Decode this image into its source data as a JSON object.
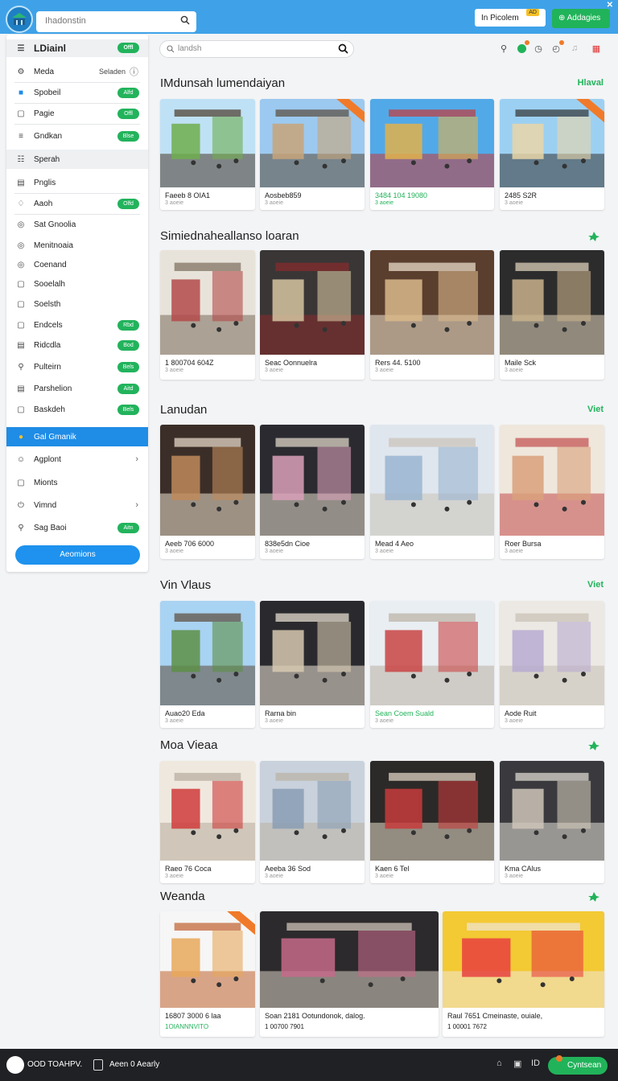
{
  "topbar": {
    "search_placeholder": "Ihadonstin",
    "button_white": "In Picolem",
    "button_white_tag": "AD",
    "button_green": "Addagies",
    "close": "✕"
  },
  "sidebar": {
    "title": "LDiainl",
    "title_pill": "Offl",
    "items": [
      {
        "label": "Meda",
        "right": "Seladen",
        "icon": "gear-icon"
      },
      {
        "label": "Spobeil",
        "pill": "Alfd",
        "icon": "blue-square-icon"
      },
      {
        "label": "Pagie",
        "pill": "Offl",
        "icon": "square-icon"
      },
      {
        "label": "Gndkan",
        "pill": "Blse",
        "icon": "list-icon"
      },
      {
        "label": "Sperah",
        "icon": "sliders-icon"
      },
      {
        "label": "Pnglis",
        "icon": "doc-icon"
      },
      {
        "label": "Aaoh",
        "pill": "Olfd",
        "icon": "bell-icon"
      },
      {
        "label": "Sat Gnoolia",
        "icon": "circle-icon"
      },
      {
        "label": "Menitnoaia",
        "icon": "circle-icon"
      },
      {
        "label": "Coenand",
        "icon": "circle-icon"
      },
      {
        "label": "Sooelalh",
        "icon": "square-icon"
      },
      {
        "label": "Soelsth",
        "icon": "square-icon"
      },
      {
        "label": "Endcels",
        "pill": "Rbd",
        "icon": "square-icon"
      },
      {
        "label": "Ridcdla",
        "pill": "Bod",
        "icon": "doc-icon"
      },
      {
        "label": "Pulteirn",
        "pill": "Bels",
        "icon": "person-icon"
      },
      {
        "label": "Parshelion",
        "pill": "Aitd",
        "icon": "doc-icon"
      },
      {
        "label": "Baskdeh",
        "pill": "Bels",
        "icon": "square-icon"
      },
      {
        "label": "Gal Gmanik",
        "icon": "dot-icon"
      },
      {
        "label": "Agplont",
        "icon": "smile-icon"
      },
      {
        "label": "Mionts",
        "icon": "square-icon"
      },
      {
        "label": "Vimnd",
        "icon": "power-icon"
      },
      {
        "label": "Sag Baoi",
        "pill": "Aitn",
        "icon": "person-icon"
      }
    ],
    "button": "Aeomions"
  },
  "main_search": {
    "placeholder": "landsh"
  },
  "sections": [
    {
      "title": "IMdunsah lumendaiyan",
      "link": "Hlaval",
      "cards": [
        {
          "title": "Faeeb 8 OIA1",
          "sub": "3 aoeie"
        },
        {
          "title": "Aosbeb859",
          "sub": "3 aoeie"
        },
        {
          "title": "3484 104 19080",
          "sub": "3 aoeie"
        },
        {
          "title": "2485 S2R",
          "sub": "3 aoeie"
        }
      ]
    },
    {
      "title": "Simiednaheallanso loaran",
      "link": "",
      "cards": [
        {
          "title": "1 800704 604Z",
          "sub": "3 aoeie"
        },
        {
          "title": "Seac Oonnuelra",
          "sub": "3 aoeie"
        },
        {
          "title": "Rers 44. 5100",
          "sub": "3 aoeie"
        },
        {
          "title": "Maile Sck",
          "sub": "3 aoeie"
        }
      ]
    },
    {
      "title": "Lanudan",
      "link": "Viet",
      "cards": [
        {
          "title": "Aeeb 706 6000",
          "sub": "3 aoeie"
        },
        {
          "title": "838e5dn Cioe",
          "sub": "3 aoeie"
        },
        {
          "title": "Mead 4 Aeo",
          "sub": "3 aoeie"
        },
        {
          "title": "Roer Bursa",
          "sub": "3 aoeie"
        }
      ]
    },
    {
      "title": "Vin Vlaus",
      "link": "Viet",
      "cards": [
        {
          "title": "Auao20 Eda",
          "sub": "3 aoeie"
        },
        {
          "title": "Rarna bin",
          "sub": "3 aoeie"
        },
        {
          "title": "Sean Coem Suald",
          "sub": "3 aoeie"
        },
        {
          "title": "Aode Ruit",
          "sub": "3 aoeie"
        }
      ]
    },
    {
      "title": "Moa Vieaa",
      "link": "",
      "cards": [
        {
          "title": "Raeo 76 Coca",
          "sub": "3 aoeie"
        },
        {
          "title": "Aeeba 36 Sod",
          "sub": "3 aoeie"
        },
        {
          "title": "Kaen 6 Tel",
          "sub": "3 aoeie"
        },
        {
          "title": "Kma CAlus",
          "sub": "3 aoeie"
        }
      ]
    },
    {
      "title": "Weanda",
      "link": "",
      "cards": [
        {
          "title": "16807 3000 6 laa",
          "sub": "1OIANNNVITO"
        },
        {
          "title": "Soan 2181 Ootundonok, dalog.",
          "sub": "1 00700 7901"
        },
        {
          "title": "Raul 7651 Cmeinaste, ouiale,",
          "sub": "1 00001 7672"
        }
      ]
    }
  ],
  "bottombar": {
    "brand": "OOD TOAHPV.",
    "text2": "Aeen 0 Aearly",
    "button": "Cyntsean"
  },
  "colors": {
    "topbar": "#3fa2e8",
    "accent_green": "#21b35a",
    "accent_blue": "#1f8ce6",
    "badge_orange": "#f07a2a"
  }
}
